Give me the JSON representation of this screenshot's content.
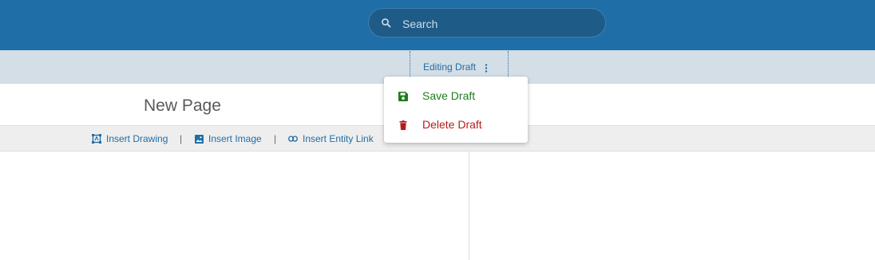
{
  "header": {
    "search": {
      "placeholder": "Search",
      "value": ""
    }
  },
  "draft_bar": {
    "label": "Editing Draft"
  },
  "dropdown": {
    "items": [
      {
        "label": "Save Draft",
        "icon": "save-icon",
        "color": "#1e7d1e"
      },
      {
        "label": "Delete Draft",
        "icon": "trash-icon",
        "color": "#b71c1c"
      }
    ]
  },
  "page": {
    "title": "New Page"
  },
  "toolbar": {
    "items": [
      {
        "label": "Insert Drawing",
        "icon": "drawing-icon"
      },
      {
        "label": "Insert Image",
        "icon": "image-icon"
      },
      {
        "label": "Insert Entity Link",
        "icon": "link-icon"
      }
    ],
    "separator": "|"
  },
  "colors": {
    "header_bg": "#206ea7",
    "subbar_bg": "#d4dee6",
    "link": "#206ea7"
  }
}
